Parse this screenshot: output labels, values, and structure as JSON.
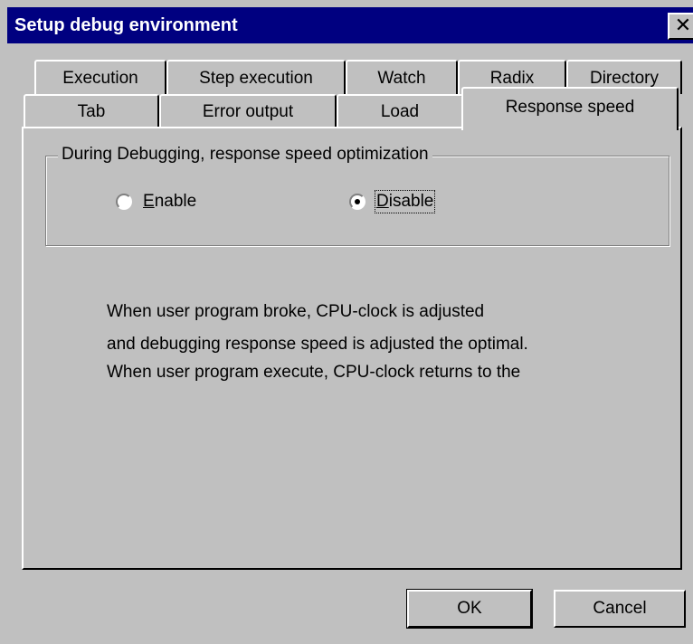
{
  "window": {
    "title": "Setup debug environment",
    "close_glyph": "✕"
  },
  "tabs": {
    "row1": [
      "Execution",
      "Step execution",
      "Watch",
      "Radix",
      "Directory"
    ],
    "row2": [
      "Tab",
      "Error output",
      "Load",
      "Response speed"
    ],
    "active": "Response speed"
  },
  "group": {
    "label": "During Debugging, response speed optimization",
    "enable": {
      "accel": "E",
      "rest": "nable",
      "selected": false
    },
    "disable": {
      "accel": "D",
      "rest": "isable",
      "selected": true
    }
  },
  "description": [
    "When user program broke, CPU-clock is adjusted",
    "and debugging response speed is adjusted the optimal.",
    "When user program execute, CPU-clock returns to the"
  ],
  "buttons": {
    "ok": "OK",
    "cancel": "Cancel"
  },
  "icons": {
    "close": "close-icon",
    "radio": "radio-icon"
  }
}
